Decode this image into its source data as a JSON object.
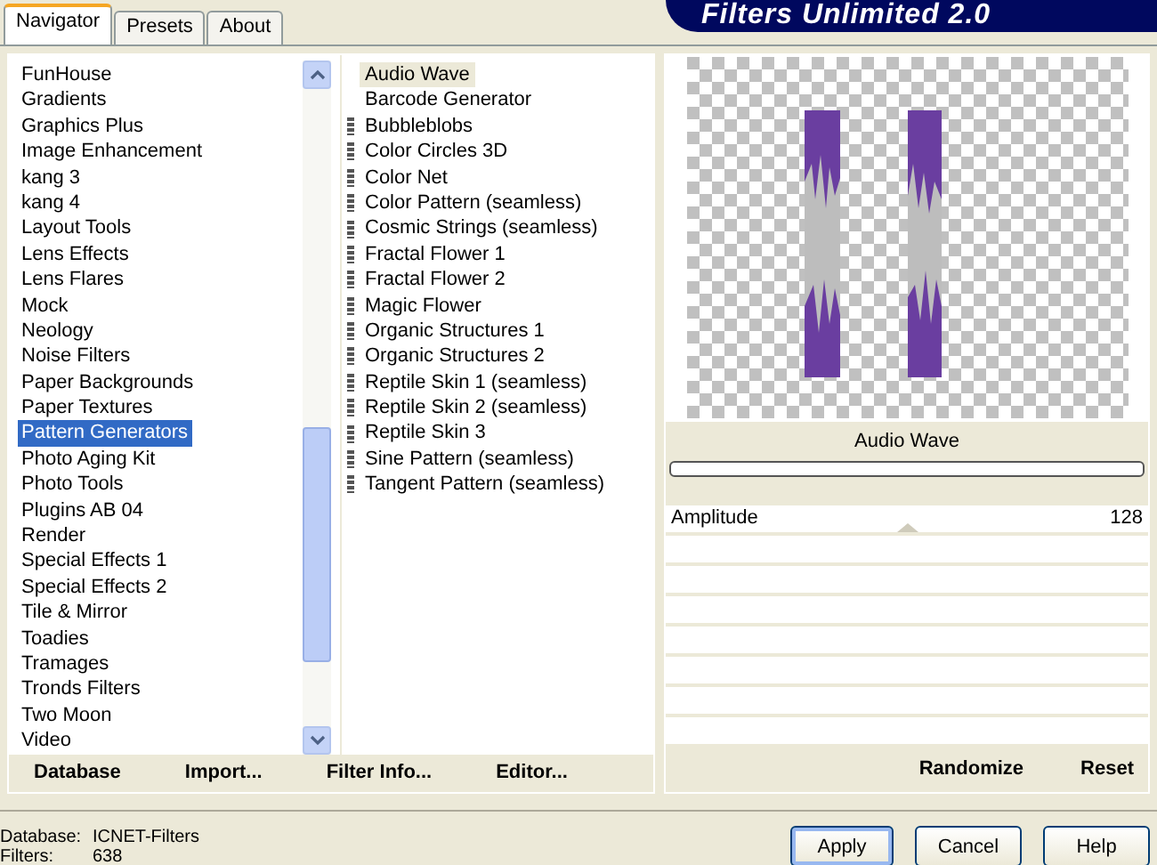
{
  "tabs": [
    {
      "label": "Navigator",
      "selected": true
    },
    {
      "label": "Presets",
      "selected": false
    },
    {
      "label": "About",
      "selected": false
    }
  ],
  "title": "Filters Unlimited 2.0",
  "categories": [
    {
      "label": "FunHouse",
      "selected": false
    },
    {
      "label": "Gradients",
      "selected": false
    },
    {
      "label": "Graphics Plus",
      "selected": false
    },
    {
      "label": "Image Enhancement",
      "selected": false
    },
    {
      "label": "kang 3",
      "selected": false
    },
    {
      "label": "kang 4",
      "selected": false
    },
    {
      "label": "Layout Tools",
      "selected": false
    },
    {
      "label": "Lens Effects",
      "selected": false
    },
    {
      "label": "Lens Flares",
      "selected": false
    },
    {
      "label": "Mock",
      "selected": false
    },
    {
      "label": "Neology",
      "selected": false
    },
    {
      "label": "Noise Filters",
      "selected": false
    },
    {
      "label": "Paper Backgrounds",
      "selected": false
    },
    {
      "label": "Paper Textures",
      "selected": false
    },
    {
      "label": "Pattern Generators",
      "selected": true
    },
    {
      "label": "Photo Aging Kit",
      "selected": false
    },
    {
      "label": "Photo Tools",
      "selected": false
    },
    {
      "label": "Plugins AB 04",
      "selected": false
    },
    {
      "label": "Render",
      "selected": false
    },
    {
      "label": "Special Effects 1",
      "selected": false
    },
    {
      "label": "Special Effects 2",
      "selected": false
    },
    {
      "label": "Tile & Mirror",
      "selected": false
    },
    {
      "label": "Toadies",
      "selected": false
    },
    {
      "label": "Tramages",
      "selected": false
    },
    {
      "label": "Tronds Filters",
      "selected": false
    },
    {
      "label": "Two Moon",
      "selected": false
    },
    {
      "label": "Video",
      "selected": false
    }
  ],
  "filters": [
    {
      "label": "Audio Wave",
      "kind": "plain",
      "selected": true
    },
    {
      "label": "Barcode Generator",
      "kind": "plain",
      "selected": false
    },
    {
      "label": "Bubbleblobs",
      "kind": "marked",
      "selected": false
    },
    {
      "label": "Color Circles 3D",
      "kind": "marked",
      "selected": false
    },
    {
      "label": "Color Net",
      "kind": "marked",
      "selected": false
    },
    {
      "label": "Color Pattern (seamless)",
      "kind": "marked",
      "selected": false
    },
    {
      "label": "Cosmic Strings (seamless)",
      "kind": "marked",
      "selected": false
    },
    {
      "label": "Fractal Flower 1",
      "kind": "marked",
      "selected": false
    },
    {
      "label": "Fractal Flower 2",
      "kind": "marked",
      "selected": false
    },
    {
      "label": "Magic Flower",
      "kind": "marked",
      "selected": false
    },
    {
      "label": "Organic Structures 1",
      "kind": "marked",
      "selected": false
    },
    {
      "label": "Organic Structures 2",
      "kind": "marked",
      "selected": false
    },
    {
      "label": "Reptile Skin 1 (seamless)",
      "kind": "marked",
      "selected": false
    },
    {
      "label": "Reptile Skin 2 (seamless)",
      "kind": "marked",
      "selected": false
    },
    {
      "label": "Reptile Skin 3",
      "kind": "marked",
      "selected": false
    },
    {
      "label": "Sine Pattern (seamless)",
      "kind": "marked",
      "selected": false
    },
    {
      "label": "Tangent Pattern (seamless)",
      "kind": "marked",
      "selected": false
    }
  ],
  "left_buttons": [
    "Database",
    "Import...",
    "Filter Info...",
    "Editor..."
  ],
  "preview": {
    "filter_name": "Audio Wave"
  },
  "parameters": [
    {
      "label": "Amplitude",
      "value": "128",
      "level": 0.5
    }
  ],
  "progress": {
    "level": 0
  },
  "right_buttons": [
    "Randomize",
    "Reset"
  ],
  "status": [
    {
      "label": "Database:",
      "value": "ICNET-Filters"
    },
    {
      "label": "Filters:",
      "value": "638"
    }
  ],
  "dialog_buttons": [
    {
      "label": "Apply",
      "default": true
    },
    {
      "label": "Cancel",
      "default": false
    },
    {
      "label": "Help",
      "default": false
    }
  ]
}
